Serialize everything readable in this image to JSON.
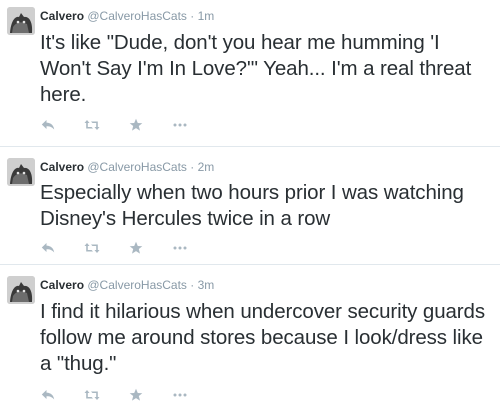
{
  "tweets": [
    {
      "author_name": "Calvero",
      "handle": "@CalveroHasCats",
      "separator": "·",
      "time": "1m",
      "text": "It's like \"Dude, don't you hear me humming 'I Won't Say I'm In Love?'\" Yeah... I'm a real threat here."
    },
    {
      "author_name": "Calvero",
      "handle": "@CalveroHasCats",
      "separator": "·",
      "time": "2m",
      "text": "Especially when two hours prior I was watching Disney's Hercules twice in a row"
    },
    {
      "author_name": "Calvero",
      "handle": "@CalveroHasCats",
      "separator": "·",
      "time": "3m",
      "text": "I find it hilarious when undercover security guards follow me around stores because I look/dress like a \"thug.\""
    }
  ],
  "action_icons": [
    "reply-icon",
    "retweet-icon",
    "favorite-icon",
    "more-icon"
  ],
  "colors": {
    "text": "#292f33",
    "muted": "#8899a6",
    "icon": "#aab8c2",
    "divider": "#e1e8ed"
  }
}
